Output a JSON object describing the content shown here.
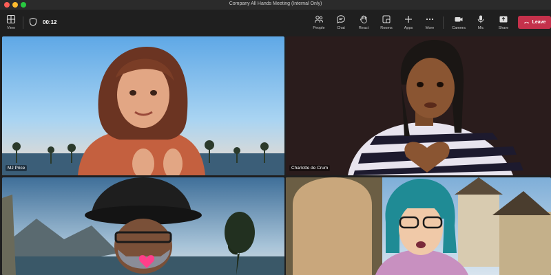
{
  "window": {
    "title": "Company All Hands Meeting (Internal Only)"
  },
  "toolbar": {
    "view_label": "View",
    "timer": "00:12",
    "people_label": "People",
    "chat_label": "Chat",
    "react_label": "React",
    "rooms_label": "Rooms",
    "apps_label": "Apps",
    "more_label": "More",
    "camera_label": "Camera",
    "mic_label": "Mic",
    "share_label": "Share",
    "leave_label": "Leave"
  },
  "participants": [
    {
      "name": "MJ Price"
    },
    {
      "name": "Charlotte de Crum"
    },
    {
      "name": ""
    },
    {
      "name": ""
    }
  ],
  "colors": {
    "leave": "#c4314b",
    "toolbar_bg": "#1f1f1f"
  }
}
